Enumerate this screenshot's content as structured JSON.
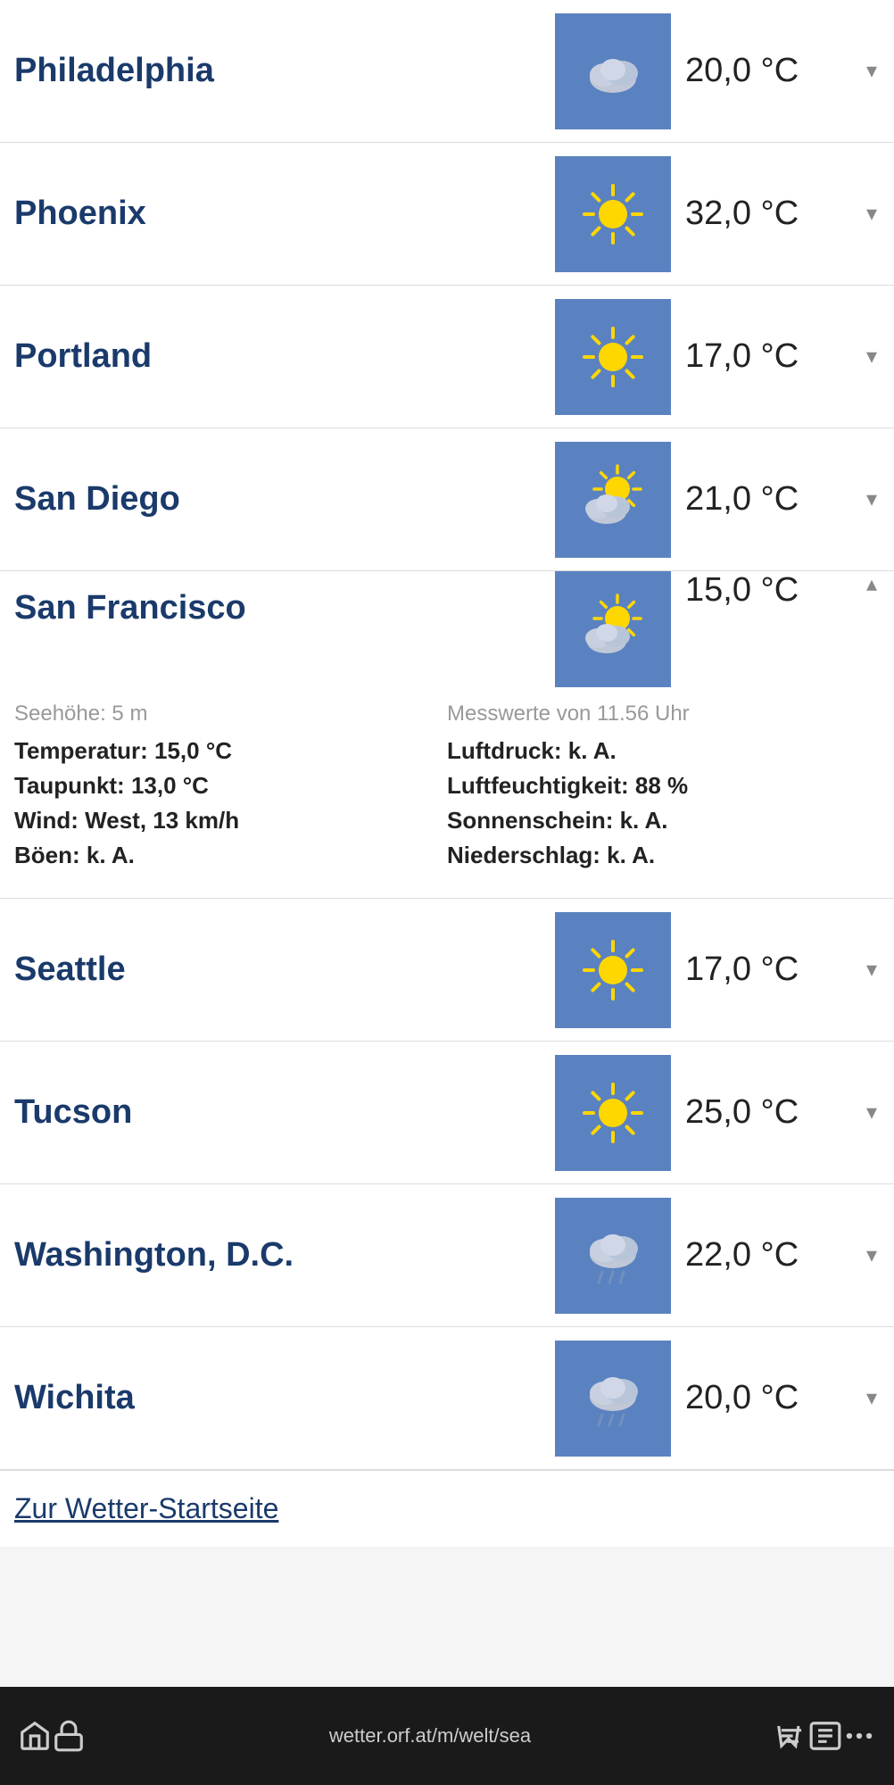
{
  "cities": [
    {
      "name": "Philadelphia",
      "temp": "20,0 °C",
      "icon": "cloud",
      "expanded": false,
      "chevron": "▾"
    },
    {
      "name": "Phoenix",
      "temp": "32,0 °C",
      "icon": "sun",
      "expanded": false,
      "chevron": "▾"
    },
    {
      "name": "Portland",
      "temp": "17,0 °C",
      "icon": "sun",
      "expanded": false,
      "chevron": "▾"
    },
    {
      "name": "San Diego",
      "temp": "21,0 °C",
      "icon": "partly-cloudy",
      "expanded": false,
      "chevron": "▾"
    },
    {
      "name": "San Francisco",
      "temp": "15,0 °C",
      "icon": "partly-cloudy",
      "expanded": true,
      "chevron": "▴",
      "detail": {
        "meta_left": "Seehöhe: 5 m",
        "meta_right": "Messwerte von 11.56 Uhr",
        "rows_left": [
          "Temperatur: 15,0 °C",
          "Taupunkt: 13,0 °C",
          "Wind: West, 13 km/h",
          "Böen: k. A."
        ],
        "rows_right": [
          "Luftdruck: k. A.",
          "Luftfeuchtigkeit: 88 %",
          "Sonnenschein: k. A.",
          "Niederschlag: k. A."
        ]
      }
    },
    {
      "name": "Seattle",
      "temp": "17,0 °C",
      "icon": "sun",
      "expanded": false,
      "chevron": "▾"
    },
    {
      "name": "Tucson",
      "temp": "25,0 °C",
      "icon": "sun",
      "expanded": false,
      "chevron": "▾"
    },
    {
      "name": "Washington, D.C.",
      "temp": "22,0 °C",
      "icon": "cloud-rain",
      "expanded": false,
      "chevron": "▾"
    },
    {
      "name": "Wichita",
      "temp": "20,0 °C",
      "icon": "cloud-rain",
      "expanded": false,
      "chevron": "▾"
    }
  ],
  "footer": {
    "link_text": "Zur Wetter-Startseite"
  },
  "bottom_nav": {
    "url": "wetter.orf.at/m/welt/sea"
  }
}
